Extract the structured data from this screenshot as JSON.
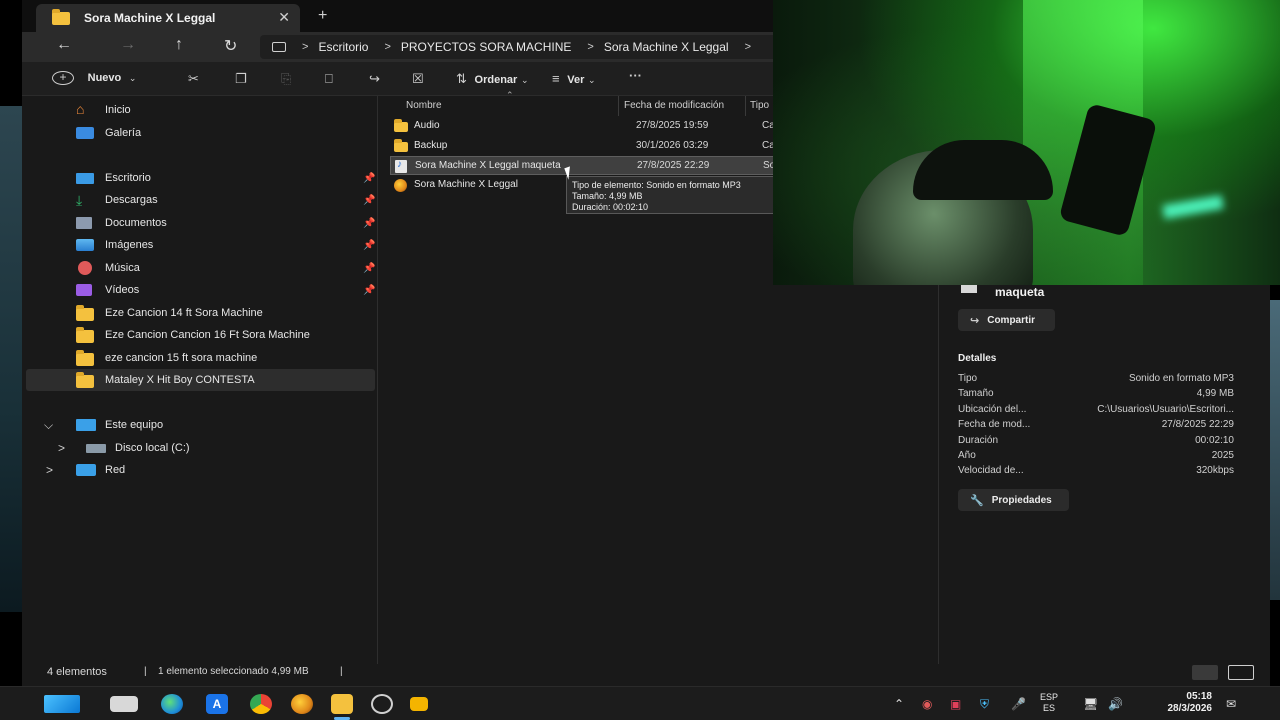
{
  "window": {
    "tab_title": "Sora Machine X Leggal",
    "tab_close": "✕",
    "tab_add": "+"
  },
  "address": {
    "crumbs": [
      "Escritorio",
      "PROYECTOS SORA MACHINE",
      "Sora Machine X Leggal"
    ],
    "separator": ">"
  },
  "toolbar": {
    "new_label": "Nuevo",
    "sort_label": "Ordenar",
    "view_label": "Ver",
    "more": "···"
  },
  "sidebar": {
    "home": "Inicio",
    "gallery": "Galería",
    "pinned": [
      {
        "label": "Escritorio",
        "icon": "desktop-icon"
      },
      {
        "label": "Descargas",
        "icon": "download-icon"
      },
      {
        "label": "Documentos",
        "icon": "documents-icon"
      },
      {
        "label": "Imágenes",
        "icon": "pictures-icon"
      },
      {
        "label": "Música",
        "icon": "music-icon"
      },
      {
        "label": "Vídeos",
        "icon": "videos-icon"
      }
    ],
    "folders": [
      "Eze Cancion 14 ft Sora Machine",
      "Eze Cancion Cancion 16 Ft Sora Machine",
      "eze cancion 15 ft sora machine",
      "Mataley X Hit Boy CONTESTA"
    ],
    "this_pc": "Este equipo",
    "local_disk": "Disco local (C:)",
    "network": "Red"
  },
  "list": {
    "headers": {
      "name": "Nombre",
      "modified": "Fecha de modificación",
      "type": "Tipo"
    },
    "rows": [
      {
        "name": "Audio",
        "date": "27/8/2025 19:59",
        "type": "Carp"
      },
      {
        "name": "Backup",
        "date": "30/1/2026 03:29",
        "type": "Carp"
      },
      {
        "name": "Sora Machine X Leggal maqueta",
        "date": "27/8/2025 22:29",
        "type": "Soni"
      },
      {
        "name": "Sora Machine X Leggal",
        "date": "",
        "type": ""
      }
    ],
    "tooltip": {
      "line1": "Tipo de elemento: Sonido en formato MP3",
      "line2": "Tamaño: 4,99 MB",
      "line3": "Duración: 00:02:10"
    }
  },
  "details": {
    "title": "maqueta",
    "share": "Compartir",
    "heading": "Detalles",
    "props": [
      {
        "k": "Tipo",
        "v": "Sonido en formato MP3"
      },
      {
        "k": "Tamaño",
        "v": "4,99 MB"
      },
      {
        "k": "Ubicación del...",
        "v": "C:\\Usuarios\\Usuario\\Escritori..."
      },
      {
        "k": "Fecha de mod...",
        "v": "27/8/2025 22:29"
      },
      {
        "k": "Duración",
        "v": "00:02:10"
      },
      {
        "k": "Año",
        "v": "2025"
      },
      {
        "k": "Velocidad de...",
        "v": "320kbps"
      }
    ],
    "properties": "Propiedades"
  },
  "status": {
    "count": "4 elementos",
    "selected": "1 elemento seleccionado  4,99 MB",
    "sep": "|"
  },
  "taskbar": {
    "lang1": "ESP",
    "lang2": "ES",
    "time": "05:18",
    "date": "28/3/2026"
  }
}
